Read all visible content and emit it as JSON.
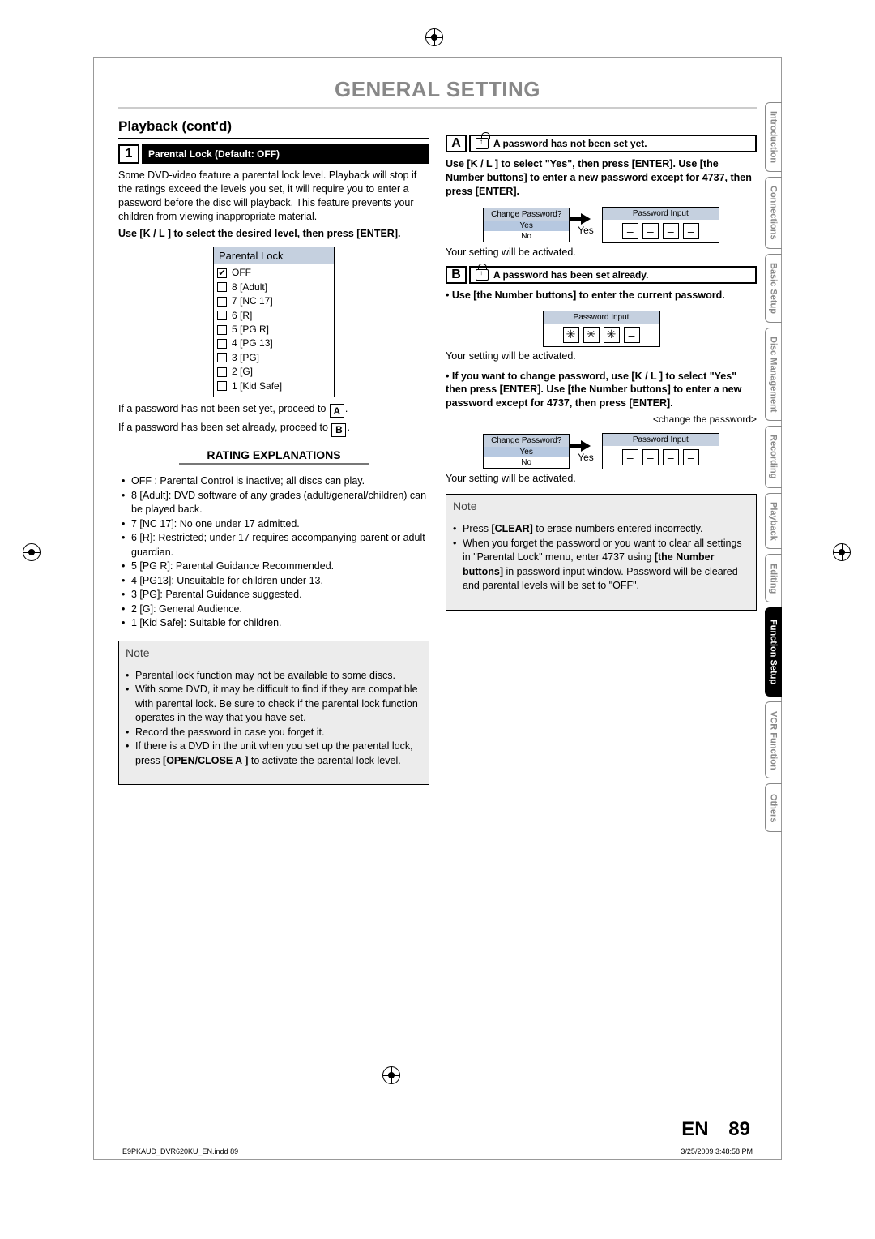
{
  "title": "GENERAL SETTING",
  "section": "Playback (cont'd)",
  "step1": {
    "num": "1",
    "label": "Parental Lock (Default: OFF)"
  },
  "intro": "Some DVD-video feature a parental lock level. Playback will stop if the ratings exceed the levels you set, it will require you to enter a password before the disc will playback. This feature prevents your children from viewing inappropriate material.",
  "instr1": "Use [K / L ] to select the desired level, then press [ENTER].",
  "menu": {
    "title": "Parental Lock",
    "items": [
      "OFF",
      "8 [Adult]",
      "7 [NC 17]",
      "6 [R]",
      "5 [PG R]",
      "4 [PG 13]",
      "3 [PG]",
      "2 [G]",
      "1 [Kid Safe]"
    ]
  },
  "pwNotSetLine": "If a password has not been set yet, proceed to ",
  "pwSetLine": "If a password has been set already, proceed to ",
  "ratingsHead": "RATING EXPLANATIONS",
  "ratings": [
    "OFF : Parental Control is inactive; all discs can play.",
    "8 [Adult]: DVD software of any grades (adult/general/children) can be played back.",
    "7 [NC 17]: No one under 17 admitted.",
    "6 [R]: Restricted; under 17 requires accompanying parent or adult guardian.",
    "5 [PG R]: Parental Guidance Recommended.",
    "4 [PG13]: Unsuitable for children under 13.",
    "3 [PG]: Parental Guidance suggested.",
    "2 [G]: General Audience.",
    "1 [Kid Safe]: Suitable for children."
  ],
  "note1": {
    "title": "Note",
    "items": [
      "Parental lock function may not be available to some discs.",
      "With some DVD, it may be difficult to find if they are compatible with parental lock. Be sure to check if the parental lock function operates in the way that you have set.",
      "Record the password in case you forget it.",
      "If there is a DVD in the unit when you set up the parental lock, press [OPEN/CLOSE A ] to activate the parental lock level."
    ]
  },
  "right": {
    "A": {
      "letter": "A",
      "text": "A password has not been set yet."
    },
    "instrA": "Use [K / L ] to select \"Yes\", then press [ENTER]. Use [the Number buttons] to enter a new password except for 4737, then press [ENTER].",
    "dlg": {
      "title": "Change Password?",
      "opt1": "Yes",
      "opt2": "No"
    },
    "arrowLabel": "Yes",
    "pwInputTitle": "Password Input",
    "activated": "Your setting will be activated.",
    "B": {
      "letter": "B",
      "text": "A password has been set already."
    },
    "instrB": "Use [the Number buttons] to enter the current password.",
    "instrB2_part1": "If you want to change password, use [K / L ] to select \"Yes\" then press [ENTER]. Use [the Number buttons] to enter a new password except for 4737, then press [ENTER].",
    "changePwCaption": "<change the password>"
  },
  "note2": {
    "title": "Note",
    "items": [
      "Press [CLEAR] to erase numbers entered incorrectly.",
      "When you forget the password or you want to clear all settings in \"Parental Lock\" menu, enter 4737 using [the Number buttons] in password input window. Password will be cleared and parental levels will be set to \"OFF\"."
    ]
  },
  "tabs": [
    "Introduction",
    "Connections",
    "Basic Setup",
    "Disc Management",
    "Recording",
    "Playback",
    "Editing",
    "Function Setup",
    "VCR Function",
    "Others"
  ],
  "activeTab": "Function Setup",
  "footer": {
    "lang": "EN",
    "page": "89"
  },
  "meta": {
    "file": "E9PKAUD_DVR620KU_EN.indd   89",
    "date": "3/25/2009  3:48:58 PM"
  }
}
